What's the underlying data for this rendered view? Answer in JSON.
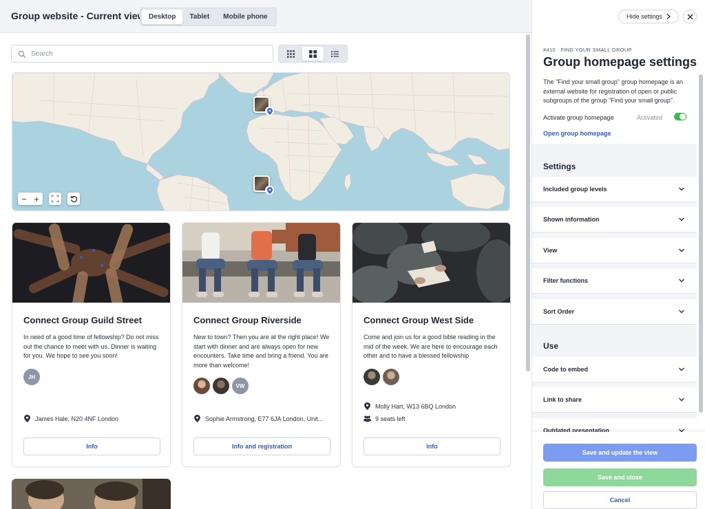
{
  "header": {
    "title": "Group website - Current view",
    "device_tabs": [
      {
        "label": "Desktop",
        "active": true
      },
      {
        "label": "Tablet",
        "active": false
      },
      {
        "label": "Mobile phone",
        "active": false
      }
    ]
  },
  "search": {
    "placeholder": "Search",
    "value": ""
  },
  "view_modes": [
    {
      "icon": "grid-small-icon",
      "active": false
    },
    {
      "icon": "grid-large-icon",
      "active": true
    },
    {
      "icon": "list-icon",
      "active": false
    }
  ],
  "map": {
    "controls": [
      "zoom-out-icon",
      "zoom-in-icon",
      "fullscreen-icon",
      "reset-icon"
    ],
    "markers": [
      "Europe",
      "Central Africa"
    ]
  },
  "cards": [
    {
      "title": "Connect Group Guild Street",
      "description": "In need of a good time of fellowship? Do not miss out the chance to meet with us. Dinner is waiting for you. We hope to see you soon!",
      "avatars": [
        "JH"
      ],
      "location": "James Hale, N20 4NF London",
      "seats": "",
      "button": "Info"
    },
    {
      "title": "Connect Group Riverside",
      "description": "New to town? Then you are at the right place! We start with dinner and are always open for new encounters. Take time and bring a friend. You are more than welcome!",
      "avatars": [
        "photo",
        "photo",
        "VW"
      ],
      "location": "Sophie Armstrong, E77 6JA London, Unit...",
      "seats": "",
      "button": "Info and registration"
    },
    {
      "title": "Connect Group West Side",
      "description": "Come and join us for a good bible reading in the mid of the week. We are here to encourage each other and to have a blessed fellowship",
      "avatars": [
        "photo",
        "photo"
      ],
      "location": "Molly Hart, W13 6BQ London",
      "seats": "9 seats left",
      "button": "Info"
    }
  ],
  "panel": {
    "hide_settings": "Hide settings",
    "crumb": "#410 · FIND YOUR SMALL GROUP",
    "title": "Group homepage settings",
    "description": "The \"Find your small group\" group homepage is an external website for registration of open or public subgroups of the group \"Find your small group\".",
    "activate_label": "Activate group homepage",
    "activate_status": "Activated",
    "activated": true,
    "open_link": "Open group homepage",
    "settings_heading": "Settings",
    "settings_items": [
      "Included group levels",
      "Shown information",
      "View",
      "Filter functions",
      "Sort Order"
    ],
    "use_heading": "Use",
    "use_items": [
      "Code to embed",
      "Link to share",
      "Outdated presentation"
    ],
    "buttons": {
      "save_update": "Save and update the view",
      "save_close": "Save and close",
      "cancel": "Cancel"
    }
  },
  "colors": {
    "accent": "#3358c4",
    "primary_button": "#7b9cf0",
    "success_button": "#8ed99a",
    "toggle_on": "#3fb950",
    "map_water": "#abd3df",
    "map_land": "#f1ede3"
  }
}
